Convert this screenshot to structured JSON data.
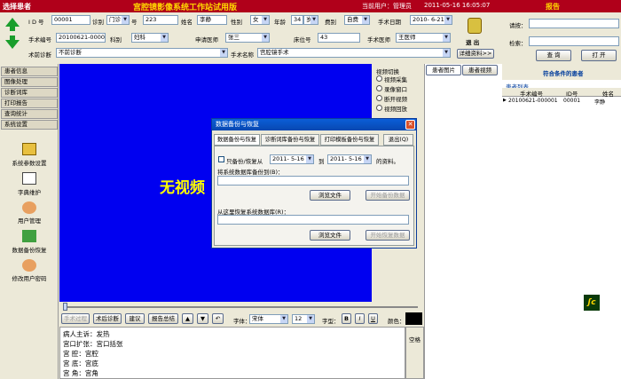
{
  "titlebar": {
    "select_patient": "选择患者",
    "title": "宫腔镜影像系统工作站试用版",
    "user_label": "当前用户：管理员",
    "datetime": "2011-05-16  16:05:07",
    "report": "报告"
  },
  "form": {
    "id_label": "I D 号",
    "id_value": "00001",
    "ward_label": "诊别",
    "ward_value": "门诊",
    "num_label": "号",
    "num_value": "223",
    "name_label": "姓名",
    "name_value": "李静",
    "sex_label": "性别",
    "sex_value": "女",
    "age_label": "年龄",
    "age_value": "34",
    "age_unit": "岁",
    "fee_label": "费别",
    "fee_value": "自费",
    "surgdate_label": "手术日期",
    "surgdate_value": "2010- 6-21",
    "surgno_label": "手术编号",
    "surgno_value": "20100621-000001",
    "dept_label": "科别",
    "dept_value": "妇科",
    "doctor_label": "申请医师",
    "doctor_value": "张三",
    "bed_label": "床位号",
    "bed_value": "43",
    "surgeon_label": "手术医师",
    "surgeon_value": "王医师",
    "prediag_label": "术前诊断",
    "prediag_value": "不前诊断",
    "surgname_label": "手术名称",
    "surgname_value": "宫腔镜手术",
    "exit_label": "退    出",
    "detail_btn": "详细资料>>",
    "query_label": "请按：",
    "search_label": "检索：",
    "query_btn": "查  询",
    "open_btn": "打  开"
  },
  "leftnav": {
    "tabs": [
      "患者信息",
      "图像处理",
      "诊断词库",
      "打印报告",
      "查询统计",
      "系统设置"
    ],
    "items": [
      "系统参数设置",
      "字典维护",
      "用户管理",
      "数据备份恢复",
      "修改用户密码"
    ]
  },
  "video": {
    "no_video": "无视频",
    "switch_label": "视频切换",
    "options": [
      "视频采集",
      "录像窗口",
      "断开视频",
      "视频回放"
    ]
  },
  "right": {
    "tabs": [
      "患者图片",
      "患者视频"
    ],
    "header": "符合条件的患者",
    "list_label": "患者列表",
    "columns": [
      "手术编号",
      "ID号",
      "姓名"
    ],
    "rows": [
      [
        "20100621-000001",
        "00001",
        "李静"
      ]
    ]
  },
  "dialog": {
    "title": "数据备份与恢复",
    "tabs": [
      "数据备份与恢复",
      "诊断词库备份与恢复",
      "打印模板备份与恢复",
      "退出(Q)"
    ],
    "only_backup": "只备份/恢复从",
    "date_from": "2011- 5-16",
    "to_label": "到",
    "date_to": "2011- 5-16",
    "tail": "的资料。",
    "backup_to": "将系统数据库备份到(B)：",
    "browse1": "浏览文件",
    "start_backup": "开始备份数据",
    "restore_from": "从这里恢复系统数据库(R)：",
    "browse2": "浏览文件",
    "start_restore": "开始恢复数据"
  },
  "toolbar": {
    "surg_course": "手术过程",
    "post_diag": "术后诊断",
    "advice": "建议",
    "report_sum": "报告总结",
    "font_label": "字体：",
    "font_value": "宋体",
    "size_value": "12",
    "style_label": "字型：",
    "color_label": "颜色：",
    "space_label": "空格"
  },
  "text": {
    "lines": [
      "病人主诉：发热",
      "宫口扩张：宫口括张",
      "宫    腔：宫腔",
      "宫    底：宫底",
      "宫    角：宫角"
    ]
  }
}
